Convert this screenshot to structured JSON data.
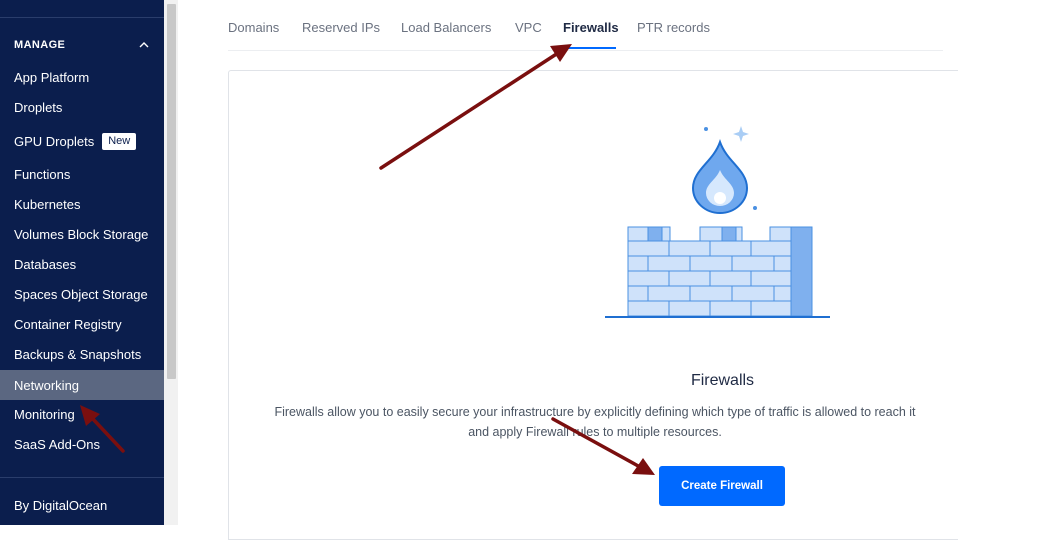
{
  "sidebar": {
    "section_title": "MANAGE",
    "items": [
      {
        "label": "App Platform"
      },
      {
        "label": "Droplets"
      },
      {
        "label": "GPU Droplets",
        "badge": "New"
      },
      {
        "label": "Functions"
      },
      {
        "label": "Kubernetes"
      },
      {
        "label": "Volumes Block Storage"
      },
      {
        "label": "Databases"
      },
      {
        "label": "Spaces Object Storage"
      },
      {
        "label": "Container Registry"
      },
      {
        "label": "Backups & Snapshots"
      },
      {
        "label": "Networking",
        "active": true
      },
      {
        "label": "Monitoring"
      },
      {
        "label": "SaaS Add-Ons"
      }
    ],
    "footer_label": "By DigitalOcean",
    "icons": {
      "collapse": "chevron-up-icon"
    }
  },
  "tabs": [
    {
      "label": "Domains"
    },
    {
      "label": "Reserved IPs"
    },
    {
      "label": "Load Balancers"
    },
    {
      "label": "VPC"
    },
    {
      "label": "Firewalls",
      "active": true
    },
    {
      "label": "PTR records"
    }
  ],
  "empty_state": {
    "title": "Firewalls",
    "description_line1": "Firewalls allow you to easily secure your infrastructure by explicitly defining which type of traffic is allowed to reach it",
    "description_line2": "and apply Firewall rules to multiple resources.",
    "button_label": "Create Firewall",
    "illustration": "firewall-illustration"
  },
  "colors": {
    "sidebar_bg": "#0b1e4d",
    "sidebar_active": "#5b6781",
    "primary": "#0069ff",
    "annotation_arrow": "#7a0f0f",
    "illustration_blue": "#4a90e2"
  }
}
